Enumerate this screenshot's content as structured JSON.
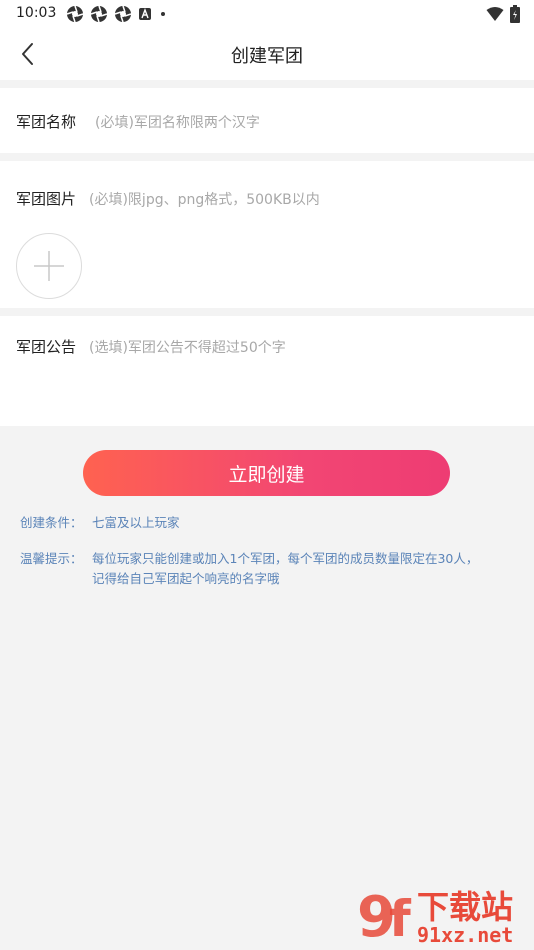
{
  "status_bar": {
    "time": "10:03",
    "left_icons": [
      "aperture-icon",
      "aperture-icon",
      "aperture-icon",
      "a-badge-icon",
      "dot-icon"
    ],
    "right_icons": [
      "wifi-icon",
      "battery-icon"
    ]
  },
  "header": {
    "title": "创建军团",
    "back_icon": "chevron-left-icon"
  },
  "form": {
    "name": {
      "label": "军团名称",
      "placeholder": "(必填)军团名称限两个汉字"
    },
    "image": {
      "label": "军团图片",
      "hint": "(必填)限jpg、png格式，500KB以内",
      "add_icon": "plus-icon"
    },
    "notice": {
      "label": "军团公告",
      "placeholder": "(选填)军团公告不得超过50个字"
    }
  },
  "actions": {
    "create_label": "立即创建"
  },
  "info": {
    "conditions_label": "创建条件：",
    "conditions_value": "七富及以上玩家",
    "tips_label": "温馨提示：",
    "tips_line1": "每位玩家只能创建或加入1个军团，每个军团的成员数量限定在30人，",
    "tips_line2": "记得给自己军团起个响亮的名字哦"
  },
  "watermark": {
    "text_top": "下载站",
    "text_bottom": "91xz.net"
  },
  "colors": {
    "button_gradient_start": "#ff6250",
    "button_gradient_end": "#ee3c73",
    "info_text": "#5b84b8",
    "placeholder": "#a8a8a8"
  }
}
